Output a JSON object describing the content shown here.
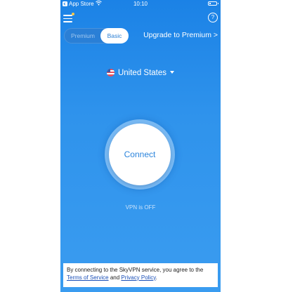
{
  "status_bar": {
    "carrier": "App Store",
    "time": "10:10"
  },
  "header": {
    "help_label": "?"
  },
  "plan_toggle": {
    "premium_label": "Premium",
    "basic_label": "Basic",
    "selected": "Basic"
  },
  "upgrade_link": "Upgrade to Premium >",
  "location": {
    "country": "United States",
    "flag_icon": "us-flag-icon"
  },
  "connect_button": {
    "label": "Connect"
  },
  "vpn_status": "VPN is OFF",
  "terms": {
    "prefix": "By connecting to the SkyVPN service, you agree to the",
    "tos_link": "Terms of Service",
    "and": "and",
    "privacy_link": "Privacy Policy",
    "suffix": "."
  },
  "colors": {
    "background_top": "#1b82e6",
    "background_bottom": "#3a9cf0",
    "accent": "#2b84dc",
    "notification_dot": "#f7c744"
  }
}
